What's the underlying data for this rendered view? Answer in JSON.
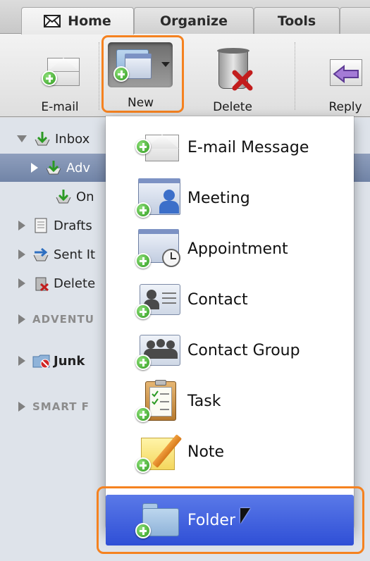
{
  "tabs": [
    {
      "label": "Home",
      "icon": "envelope-icon",
      "active": true
    },
    {
      "label": "Organize",
      "active": false
    },
    {
      "label": "Tools",
      "active": false
    }
  ],
  "ribbon": {
    "email_label": "E-mail",
    "new_label": "New",
    "delete_label": "Delete",
    "reply_label": "Reply"
  },
  "sidebar": {
    "inbox": "Inbox",
    "adv": "Adv",
    "on": "On",
    "drafts": "Drafts",
    "sent": "Sent It",
    "deleted": "Delete",
    "section_adventure": "ADVENTU",
    "junk": "Junk",
    "section_smart": "SMART F"
  },
  "menu": {
    "items": [
      {
        "label": "E-mail Message",
        "icon": "email-message-icon"
      },
      {
        "label": "Meeting",
        "icon": "meeting-icon"
      },
      {
        "label": "Appointment",
        "icon": "appointment-icon"
      },
      {
        "label": "Contact",
        "icon": "contact-icon"
      },
      {
        "label": "Contact Group",
        "icon": "contact-group-icon"
      },
      {
        "label": "Task",
        "icon": "task-icon"
      },
      {
        "label": "Note",
        "icon": "note-icon"
      },
      {
        "label": "Folder",
        "icon": "folder-icon",
        "selected": true
      }
    ]
  },
  "colors": {
    "highlight": "#f58220",
    "selection": "#3a59db",
    "sidebar_selection": "#7f91b2"
  }
}
